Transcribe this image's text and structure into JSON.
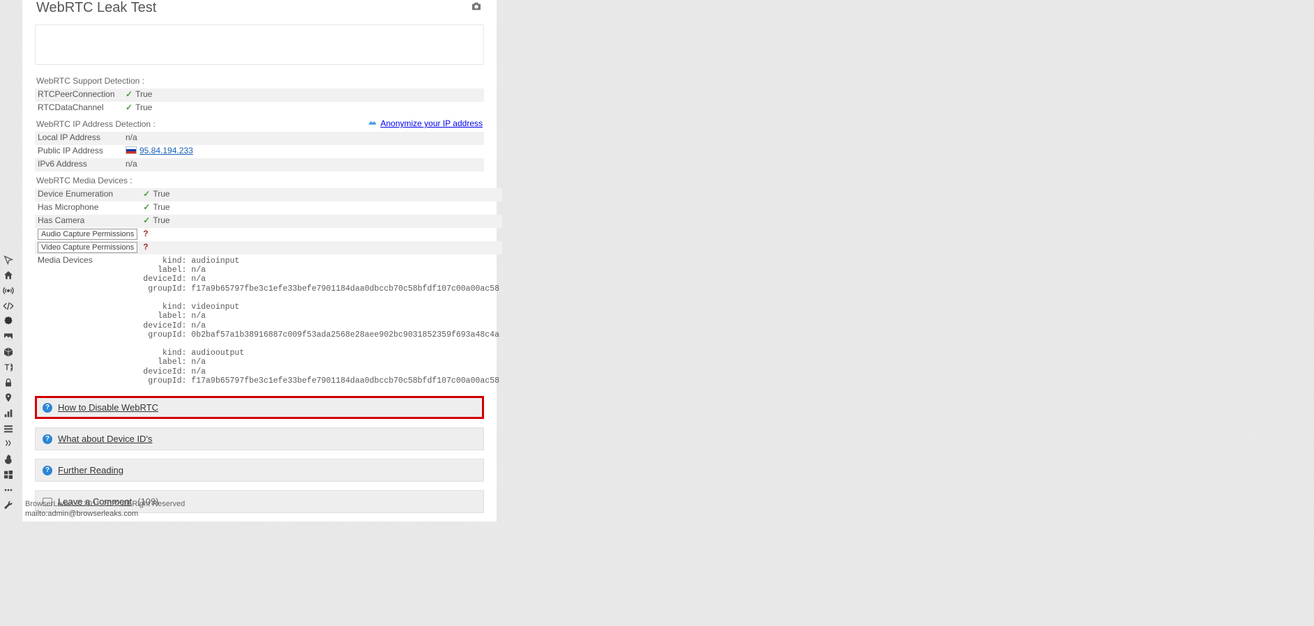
{
  "page": {
    "title": "WebRTC Leak Test"
  },
  "sections": {
    "support": {
      "title": "WebRTC Support Detection :",
      "rows": [
        {
          "key": "RTCPeerConnection",
          "val": "True",
          "check": true
        },
        {
          "key": "RTCDataChannel",
          "val": "True",
          "check": true
        }
      ]
    },
    "ip": {
      "title": "WebRTC IP Address Detection :",
      "right_link": "Anonymize your IP address",
      "rows": {
        "local": {
          "key": "Local IP Address",
          "val": "n/a"
        },
        "public": {
          "key": "Public IP Address",
          "val": "95.84.194.233"
        },
        "ipv6": {
          "key": "IPv6 Address",
          "val": "n/a"
        }
      }
    },
    "devices": {
      "title": "WebRTC Media Devices :",
      "rows": [
        {
          "key": "Device Enumeration",
          "val": "True",
          "check": true
        },
        {
          "key": "Has Microphone",
          "val": "True",
          "check": true
        },
        {
          "key": "Has Camera",
          "val": "True",
          "check": true
        }
      ],
      "perm_rows": {
        "audio": {
          "label": "Audio Capture Permissions",
          "val": "?"
        },
        "video": {
          "label": "Video Capture Permissions",
          "val": "?"
        }
      },
      "media_devices_key": "Media Devices",
      "media_devices_pre": "    kind: audioinput\n   label: n/a\ndeviceId: n/a\n groupId: f17a9b65797fbe3c1efe33befe7901184daa0dbccb70c58bfdf107c00a00ac58\n\n    kind: videoinput\n   label: n/a\ndeviceId: n/a\n groupId: 0b2baf57a1b38916887c009f53ada2568e28aee902bc9031852359f693a48c4a\n\n    kind: audiooutput\n   label: n/a\ndeviceId: n/a\n groupId: f17a9b65797fbe3c1efe33befe7901184daa0dbccb70c58bfdf107c00a00ac58"
    }
  },
  "bottom_links": {
    "disable": "How to Disable WebRTC",
    "deviceids": "What about Device ID's",
    "further": "Further Reading",
    "comment": "Leave a Comment",
    "comment_count": "(109)"
  },
  "footer": {
    "line1": "BrowserLeaks © 2011-2022 All Right Reserved",
    "line2": "mailto:admin@browserleaks.com"
  },
  "rail": {
    "items": [
      "cursor",
      "home",
      "broadcast",
      "code",
      "gear",
      "image",
      "cube",
      "text-height",
      "lock",
      "pin",
      "bar-chart",
      "list",
      "steam",
      "flash",
      "windows",
      "more",
      "tools"
    ]
  }
}
